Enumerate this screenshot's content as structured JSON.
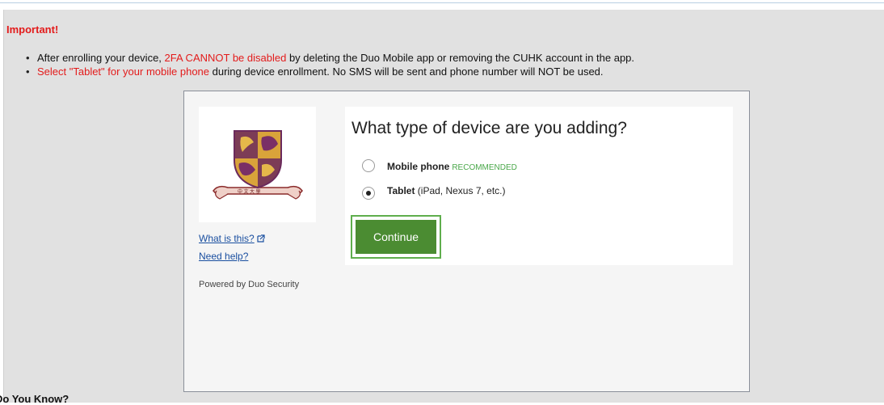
{
  "notice": {
    "heading": "Important!",
    "bullet1_pre": "After enrolling your device, ",
    "bullet1_red": "2FA CANNOT be disabled",
    "bullet1_post": " by deleting the Duo Mobile app or removing the CUHK account in the app.",
    "bullet2_red": "Select \"Tablet\" for your mobile phone",
    "bullet2_post": " during device enrollment. No SMS will be sent and phone number will NOT be used."
  },
  "duo": {
    "question": "What type of device are you adding?",
    "options": [
      {
        "label": "Mobile phone",
        "tag": "RECOMMENDED",
        "checked": false
      },
      {
        "label": "Tablet",
        "detail": " (iPad, Nexus 7, etc.)",
        "checked": true
      }
    ],
    "continue_label": "Continue",
    "what_is_this": "What is this?",
    "need_help": "Need help?",
    "powered_by": "Powered by Duo Security"
  },
  "footer": {
    "did_you_know": "Do You Know?"
  },
  "colors": {
    "alert_red": "#e31b1b",
    "continue_green": "#4b8c32",
    "recommended_green": "#4aa84a",
    "link_blue": "#1a4fa0"
  }
}
